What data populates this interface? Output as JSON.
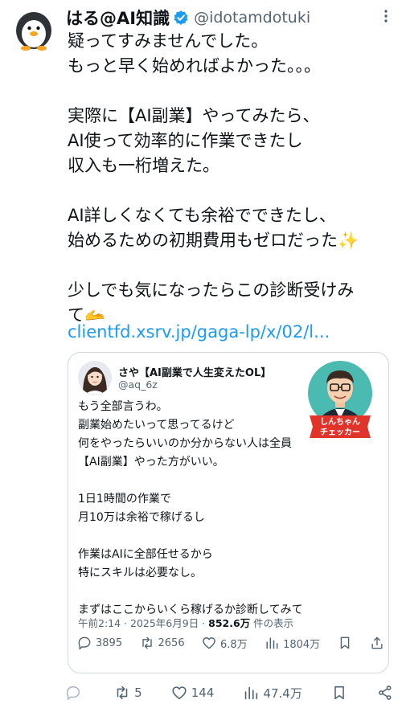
{
  "post": {
    "display_name": "はる@AI知識",
    "handle": "@idotamdotuki",
    "paragraphs": [
      [
        "疑ってすみませんでした。",
        "もっと早く始めればよかった。。。"
      ],
      [
        "実際に【AI副業】やってみたら、",
        "AI使って効率的に作業できたし",
        "収入も一桁増えた。"
      ],
      [
        "AI詳しくなくても余裕でできたし、",
        "始めるための初期費用もゼロだった✨"
      ],
      [
        "少しでも気になったらこの診断受けみ",
        "て🫴"
      ]
    ],
    "link": "clientfd.xsrv.jp/gaga-lp/x/02/l..."
  },
  "quoted": {
    "display_name": "さや【AI副業で人生変えたOL】",
    "handle": "@aq_6z",
    "badge_line1": "しんちゃん",
    "badge_line2": "チェッカー",
    "paragraphs": [
      [
        "もう全部言うわ。",
        "副業始めたいって思ってるけど",
        "何をやったらいいのか分からない人は全員",
        "【AI副業】やった方がいい。"
      ],
      [
        "1日1時間の作業で",
        "月10万は余裕で稼げるし"
      ],
      [
        "作業はAIに全部任せるから",
        "特にスキルは必要なし。"
      ],
      [
        "まずはここからいくら稼げるか診断してみて"
      ]
    ],
    "timestamp": "午前2:14 · 2025年6月9日 · ",
    "views": "852.6万",
    "views_suffix": " 件の表示",
    "replies": "3895",
    "reposts": "2656",
    "likes": "6.8万",
    "impressions": "1804万"
  },
  "actions": {
    "replies": "",
    "reposts": "5",
    "likes": "144",
    "views": "47.4万"
  },
  "icons": [
    "more-icon",
    "verified-badge-icon",
    "reply-icon",
    "repost-icon",
    "like-icon",
    "views-icon",
    "bookmark-icon",
    "share-icon"
  ],
  "colors": {
    "link": "#1d9bf0",
    "verified": "#1d9bf0",
    "muted": "#536471",
    "text": "#0f1419",
    "badge_red": "#e0342b"
  }
}
